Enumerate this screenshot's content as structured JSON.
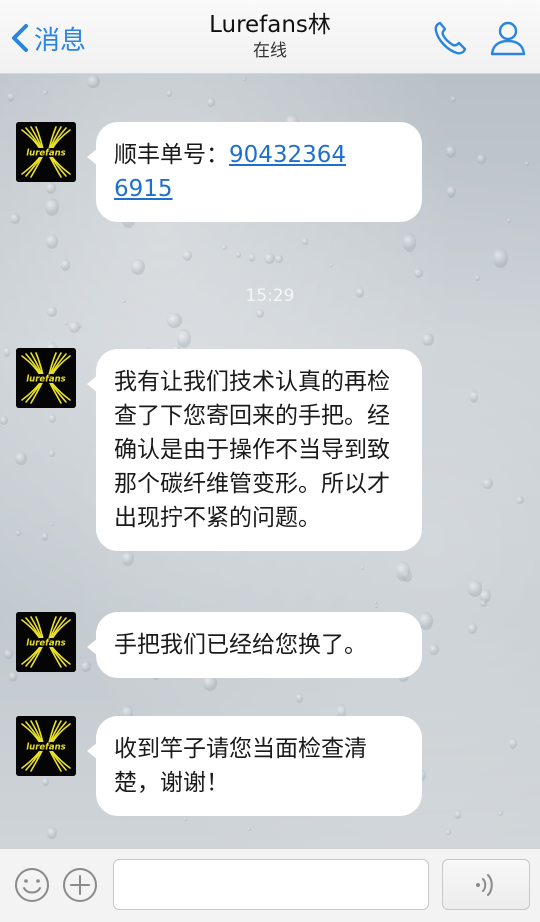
{
  "header": {
    "back_label": "消息",
    "title": "Lurefans林",
    "status": "在线"
  },
  "messages": [
    {
      "text_before": "顺丰单号：",
      "link": "904323646915",
      "text_after": ""
    },
    {
      "text": "我有让我们技术认真的再检查了下您寄回来的手把。经确认是由于操作不当导到致那个碳纤维管变形。所以才出现拧不紧的问题。"
    },
    {
      "text": "手把我们已经给您换了。"
    },
    {
      "text": "收到竿子请您当面检查清楚，谢谢！"
    }
  ],
  "timestamps": [
    "15:29"
  ],
  "avatar_label": "lurefans",
  "colors": {
    "accent": "#2a84e0",
    "link": "#1f6fd1",
    "bubble": "#ffffff",
    "avatar_bg": "#050505",
    "avatar_fg": "#e8e02a"
  },
  "icons": {
    "back": "chevron-left-icon",
    "call": "phone-icon",
    "profile": "user-icon",
    "emoji": "smiley-icon",
    "plus": "plus-icon",
    "voice": "voice-wave-icon"
  }
}
